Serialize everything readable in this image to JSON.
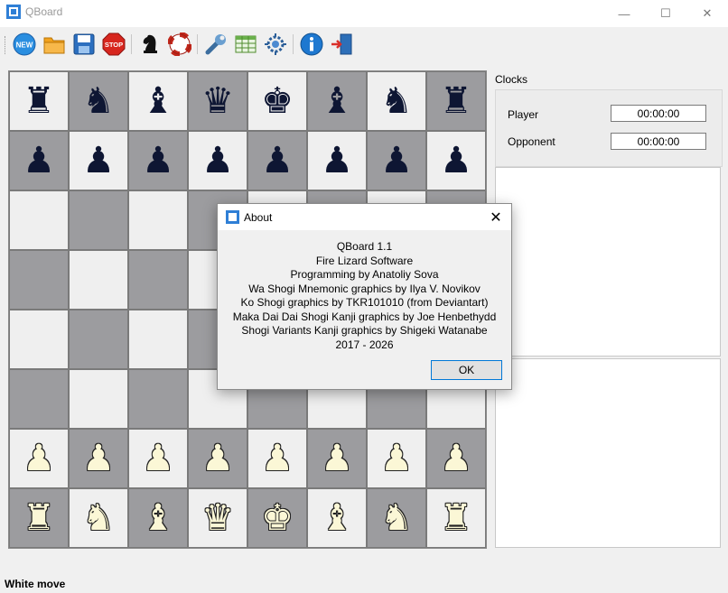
{
  "window": {
    "title": "QBoard",
    "icon": "qboard-app-icon",
    "minimize_glyph": "—",
    "maximize_glyph": "☐",
    "close_glyph": "✕"
  },
  "toolbar": {
    "buttons": [
      {
        "name": "new-icon",
        "label": "NEW"
      },
      {
        "name": "open-folder-icon"
      },
      {
        "name": "save-disk-icon"
      },
      {
        "name": "stop-icon",
        "label": "STOP"
      },
      {
        "name": "chess-knight-icon"
      },
      {
        "name": "lifebuoy-icon"
      },
      {
        "name": "wrench-icon"
      },
      {
        "name": "table-grid-icon"
      },
      {
        "name": "network-gear-icon"
      },
      {
        "name": "info-icon"
      },
      {
        "name": "exit-door-icon"
      }
    ]
  },
  "board": {
    "rows": [
      [
        "♜",
        "♞",
        "♝",
        "♛",
        "♚",
        "♝",
        "♞",
        "♜"
      ],
      [
        "♟",
        "♟",
        "♟",
        "♟",
        "♟",
        "♟",
        "♟",
        "♟"
      ],
      [
        "",
        "",
        "",
        "",
        "",
        "",
        "",
        ""
      ],
      [
        "",
        "",
        "",
        "",
        "",
        "",
        "",
        ""
      ],
      [
        "",
        "",
        "",
        "",
        "",
        "",
        "",
        ""
      ],
      [
        "",
        "",
        "",
        "",
        "",
        "",
        "",
        ""
      ],
      [
        "♟",
        "♟",
        "♟",
        "♟",
        "♟",
        "♟",
        "♟",
        "♟"
      ],
      [
        "♜",
        "♞",
        "♝",
        "♛",
        "♚",
        "♝",
        "♞",
        "♜"
      ]
    ],
    "piece_colors": [
      "black",
      "black",
      "",
      "",
      "",
      "",
      "white",
      "white"
    ],
    "light_color": "#efefef",
    "dark_color": "#9c9c9f"
  },
  "clocks": {
    "title": "Clocks",
    "player_label": "Player",
    "player_time": "00:00:00",
    "opponent_label": "Opponent",
    "opponent_time": "00:00:00"
  },
  "status": {
    "text": "White move"
  },
  "about_dialog": {
    "title": "About",
    "close_glyph": "✕",
    "lines": [
      "QBoard 1.1",
      "Fire Lizard Software",
      "Programming by Anatoliy Sova",
      "Wa Shogi Mnemonic graphics by Ilya V. Novikov",
      "Ko Shogi graphics by TKR101010 (from Deviantart)",
      "Maka Dai Dai Shogi Kanji graphics by Joe Henbethydd",
      "Shogi Variants Kanji graphics by Shigeki Watanabe",
      "2017 - 2026"
    ],
    "ok_label": "OK"
  }
}
